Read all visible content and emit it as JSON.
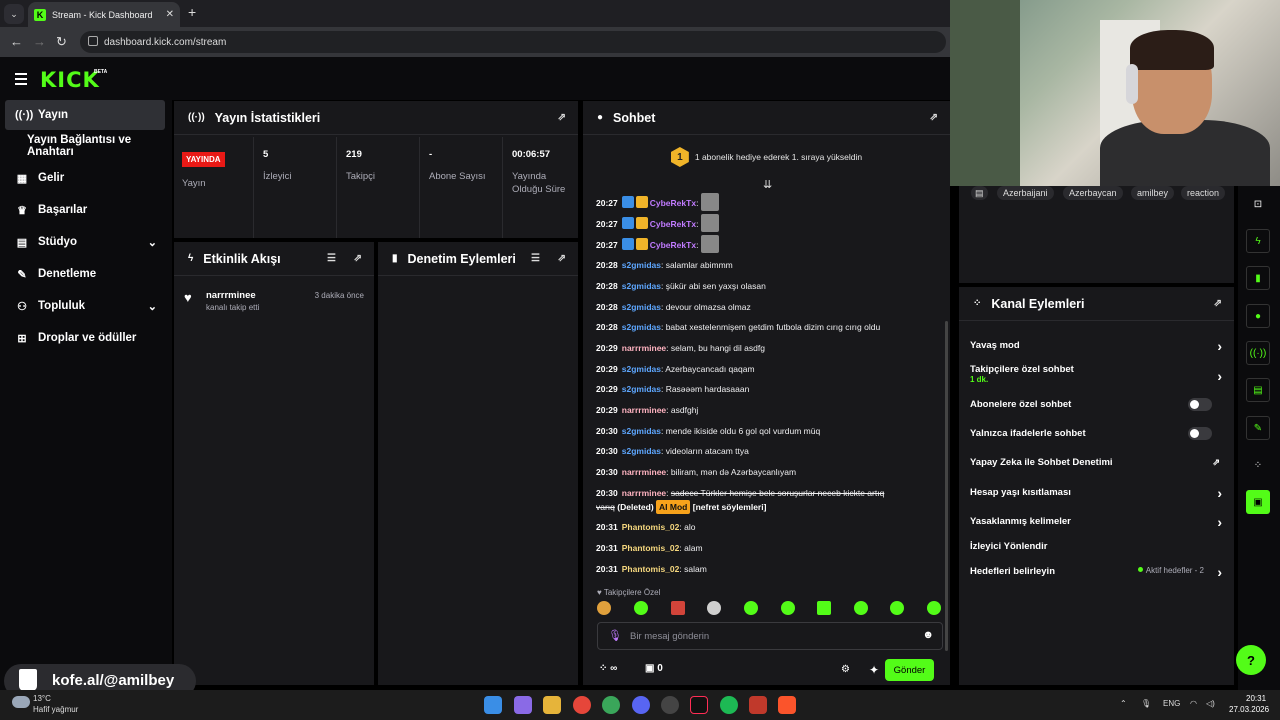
{
  "browser": {
    "tab_title": "Stream - Kick Dashboard",
    "url": "dashboard.kick.com/stream"
  },
  "brand": {
    "logo": "KICK",
    "beta": "BETA",
    "accent_color": "#53fc18"
  },
  "sidebar": {
    "items": [
      {
        "label": "Yayın",
        "icon": "broadcast-icon",
        "active": true
      },
      {
        "label": "Yayın Bağlantısı ve Anahtarı",
        "icon": "",
        "active": false
      },
      {
        "label": "Gelir",
        "icon": "chart-icon",
        "active": false
      },
      {
        "label": "Başarılar",
        "icon": "trophy-icon",
        "active": false
      },
      {
        "label": "Stüdyo",
        "icon": "studio-icon",
        "active": false,
        "expandable": true
      },
      {
        "label": "Denetleme",
        "icon": "wrench-icon",
        "active": false
      },
      {
        "label": "Topluluk",
        "icon": "community-icon",
        "active": false,
        "expandable": true
      },
      {
        "label": "Droplar ve ödüller",
        "icon": "gift-icon",
        "active": false
      }
    ]
  },
  "stats": {
    "title": "Yayın İstatistikleri",
    "live_badge": "YAYINDA",
    "items": [
      {
        "value": "",
        "label": "Yayın"
      },
      {
        "value": "5",
        "label": "İzleyici"
      },
      {
        "value": "219",
        "label": "Takipçi"
      },
      {
        "value": "-",
        "label": "Abone Sayısı"
      },
      {
        "value": "00:06:57",
        "label": "Yayında Olduğu Süre"
      }
    ]
  },
  "activity": {
    "title": "Etkinlik Akışı",
    "events": [
      {
        "user": "narrrminee",
        "desc": "kanalı takip etti",
        "time": "3 dakika önce"
      }
    ]
  },
  "moderation": {
    "title": "Denetim Eylemleri"
  },
  "chat": {
    "title": "Sohbet",
    "banner_rank": "1",
    "banner": "1 abonelik hediye ederek 1. sıraya yükseldin",
    "messages": [
      {
        "time": "20:27",
        "user": "CybeRekTx",
        "color": "purple",
        "text": ":",
        "badges": true,
        "emote": true
      },
      {
        "time": "20:27",
        "user": "CybeRekTx",
        "color": "purple",
        "text": ":",
        "badges": true,
        "emote": true
      },
      {
        "time": "20:27",
        "user": "CybeRekTx",
        "color": "purple",
        "text": ":",
        "badges": true,
        "emote": true
      },
      {
        "time": "20:28",
        "user": "s2gmidas",
        "color": "blue",
        "text": ": salamlar abimmm"
      },
      {
        "time": "20:28",
        "user": "s2gmidas",
        "color": "blue",
        "text": ": şükür abi sen yaxşı olasan"
      },
      {
        "time": "20:28",
        "user": "s2gmidas",
        "color": "blue",
        "text": ": devour olmazsa olmaz"
      },
      {
        "time": "20:28",
        "user": "s2gmidas",
        "color": "blue",
        "text": ": babat xestelenmişem getdim futbola dizim cırıg cırıg oldu"
      },
      {
        "time": "20:29",
        "user": "narrrminee",
        "color": "pink",
        "text": ": selam, bu hangi dil asdfg"
      },
      {
        "time": "20:29",
        "user": "s2gmidas",
        "color": "blue",
        "text": ": Azerbaycancadı qaqam"
      },
      {
        "time": "20:29",
        "user": "s2gmidas",
        "color": "blue",
        "text": ": Rasəəəm hardasaaan"
      },
      {
        "time": "20:29",
        "user": "narrrminee",
        "color": "pink",
        "text": ": asdfghj"
      },
      {
        "time": "20:30",
        "user": "s2gmidas",
        "color": "blue",
        "text": ": mende ikiside oldu 6 gol qol vurdum müq"
      },
      {
        "time": "20:30",
        "user": "s2gmidas",
        "color": "blue",
        "text": ": videoların atacam ttya"
      },
      {
        "time": "20:30",
        "user": "narrrminee",
        "color": "pink",
        "text": ": biliram, mən də Azərbaycanlıyam"
      },
      {
        "time": "20:31",
        "user": "Phantomis_02",
        "color": "gold",
        "text": ": alo"
      },
      {
        "time": "20:31",
        "user": "Phantomis_02",
        "color": "gold",
        "text": ": alam"
      },
      {
        "time": "20:31",
        "user": "Phantomis_02",
        "color": "gold",
        "text": ": salam"
      }
    ],
    "deleted_message": {
      "time": "20:30",
      "user": "narrrminee",
      "text_line1": "sadece Türkler hemişe bele soruşurlar neceb kickte artıq",
      "text_line2": "varıq",
      "deleted_tag": "(Deleted)",
      "mod_tag": "AI Mod",
      "reason": "[nefret söylemleri]"
    },
    "follower_only_label": "Takipçilere Özel",
    "input_placeholder": "Bir mesaj gönderin",
    "points": "∞",
    "shop_count": "0",
    "send_label": "Gönder"
  },
  "tags": [
    "Azerbaijani",
    "Azerbaycan",
    "amilbey",
    "reaction"
  ],
  "channel_actions": {
    "title": "Kanal Eylemleri",
    "rows": [
      {
        "label": "Yavaş mod",
        "kind": "chevron"
      },
      {
        "label": "Takipçilere özel sohbet",
        "sub": "1 dk.",
        "kind": "chevron"
      },
      {
        "label": "Abonelere özel sohbet",
        "kind": "toggle"
      },
      {
        "label": "Yalnızca ifadelerle sohbet",
        "kind": "toggle"
      },
      {
        "label": "Yapay Zeka ile Sohbet Denetimi",
        "kind": "external"
      },
      {
        "label": "Hesap yaşı kısıtlaması",
        "kind": "chevron"
      },
      {
        "label": "Yasaklanmış kelimeler",
        "kind": "chevron"
      },
      {
        "label": "İzleyici Yönlendir",
        "kind": "none"
      },
      {
        "label": "Hedefleri belirleyin",
        "kind": "chevron",
        "status": "Aktif hedefler - 2"
      }
    ]
  },
  "overlay": {
    "kofe": "kofe.al/@amilbey"
  },
  "taskbar": {
    "weather_temp": "13°C",
    "weather_desc": "Hafif yağmur",
    "lang": "ENG",
    "time": "20:31",
    "date": "27.03.2026"
  }
}
